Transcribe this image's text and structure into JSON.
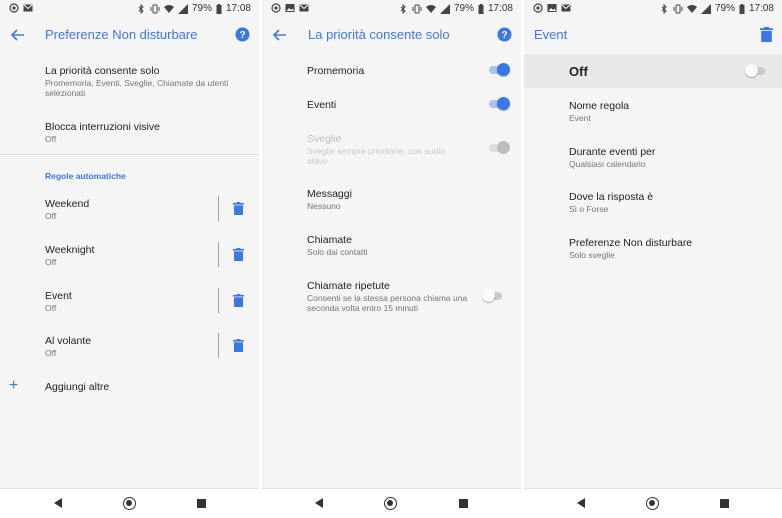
{
  "status": {
    "battery": "79%",
    "time": "17:08"
  },
  "colors": {
    "accent": "#3b78e7",
    "background": "#f5f5f5"
  },
  "panel1": {
    "title": "Preferenze Non disturbare",
    "items": [
      {
        "title": "La priorità consente solo",
        "subtitle": "Promemoria, Eventi, Sveglie, Chiamate da utenti selezionati"
      },
      {
        "title": "Blocca interruzioni visive",
        "subtitle": "Off"
      }
    ],
    "section_header": "Regole automatiche",
    "rules": [
      {
        "title": "Weekend",
        "subtitle": "Off"
      },
      {
        "title": "Weeknight",
        "subtitle": "Off"
      },
      {
        "title": "Event",
        "subtitle": "Off"
      },
      {
        "title": "Al volante",
        "subtitle": "Off"
      }
    ],
    "add_label": "Aggiungi altre",
    "icons": {
      "back": "back-arrow-icon",
      "help": "help-circle-icon",
      "delete": "trash-icon",
      "add": "plus-icon"
    }
  },
  "panel2": {
    "title": "La priorità consente solo",
    "items": [
      {
        "title": "Promemoria",
        "subtitle": "",
        "toggle": "on"
      },
      {
        "title": "Eventi",
        "subtitle": "",
        "toggle": "on"
      },
      {
        "title": "Sveglie",
        "subtitle": "Sveglie sempre prioritarie, con audio attivo",
        "toggle": "disabled-on"
      },
      {
        "title": "Messaggi",
        "subtitle": "Nessuno"
      },
      {
        "title": "Chiamate",
        "subtitle": "Solo dai contatti"
      },
      {
        "title": "Chiamate ripetute",
        "subtitle": "Consenti se la stessa persona chiama una seconda volta entro 15 minuti",
        "toggle": "off"
      }
    ]
  },
  "panel3": {
    "title": "Event",
    "master_label": "Off",
    "master_toggle": "off",
    "items": [
      {
        "title": "Nome regola",
        "subtitle": "Event"
      },
      {
        "title": "Durante eventi per",
        "subtitle": "Qualsiasi calendario"
      },
      {
        "title": "Dove la risposta è",
        "subtitle": "Sì o Forse"
      },
      {
        "title": "Preferenze Non disturbare",
        "subtitle": "Solo sveglie"
      }
    ]
  }
}
